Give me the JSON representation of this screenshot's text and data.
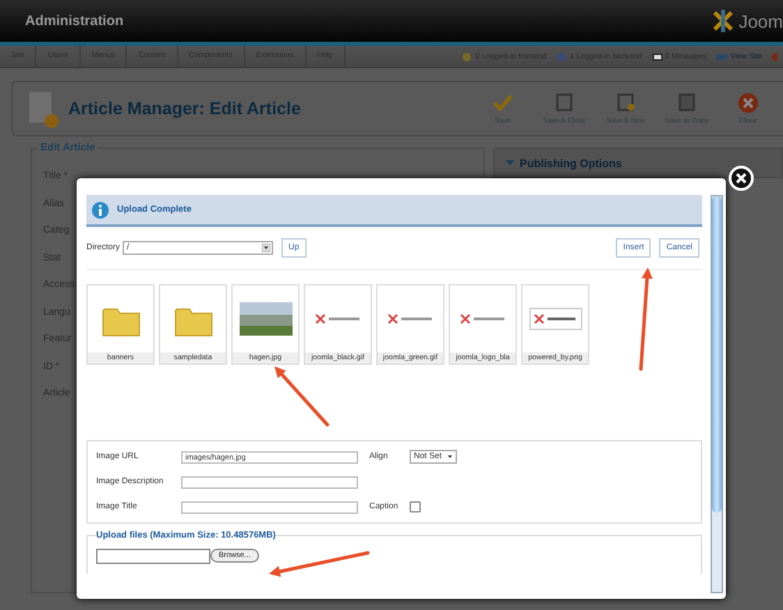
{
  "header": {
    "title": "Administration",
    "logo_text": "Joom"
  },
  "menu": {
    "items": [
      "Site",
      "Users",
      "Menus",
      "Content",
      "Components",
      "Extensions",
      "Help"
    ],
    "status": [
      {
        "kind": "frontend",
        "text": "0 Logged-in frontend"
      },
      {
        "kind": "backend",
        "text": "1 Logged-in backend"
      },
      {
        "kind": "messages",
        "text": "0 Messages"
      },
      {
        "kind": "site",
        "text": "View Site"
      }
    ]
  },
  "toolbar": {
    "title": "Article Manager: Edit Article",
    "buttons": [
      {
        "kind": "save",
        "label": "Save"
      },
      {
        "kind": "save_close",
        "label": "Save & Close"
      },
      {
        "kind": "save_new",
        "label": "Save & New"
      },
      {
        "kind": "save_copy",
        "label": "Save as Copy"
      },
      {
        "kind": "close",
        "label": "Close"
      }
    ]
  },
  "edit_form": {
    "legend": "Edit Article",
    "labels": [
      "Title *",
      "Alias",
      "Categ",
      "Stat",
      "Access",
      "Langu",
      "Featur",
      "ID *",
      "Article"
    ]
  },
  "publishing": {
    "title": "Publishing Options"
  },
  "modal": {
    "message": "Upload Complete",
    "directory_label": "Directory",
    "directory_value": "/",
    "up_button": "Up",
    "insert_button": "Insert",
    "cancel_button": "Cancel",
    "files": [
      {
        "name": "banners",
        "kind": "folder"
      },
      {
        "name": "sampledata",
        "kind": "folder"
      },
      {
        "name": "hagen.jpg",
        "kind": "photo"
      },
      {
        "name": "joomla_black.gif",
        "kind": "logo"
      },
      {
        "name": "joomla_green.gif",
        "kind": "logo"
      },
      {
        "name": "joomla_logo_bla",
        "kind": "logo"
      },
      {
        "name": "powered_by.png",
        "kind": "badge"
      }
    ],
    "fields": [
      {
        "label": "Image URL",
        "value": "images/hagen.jpg",
        "side_label": "Align",
        "kind": "select",
        "side_value": "Not Set"
      },
      {
        "label": "Image Description"
      },
      {
        "label": "Image Title",
        "side_label": "Caption",
        "kind": "checkbox",
        "checked": false
      }
    ],
    "upload_legend": "Upload files (Maximum Size: 10.48576MB)",
    "browse_button": "Browse..."
  }
}
